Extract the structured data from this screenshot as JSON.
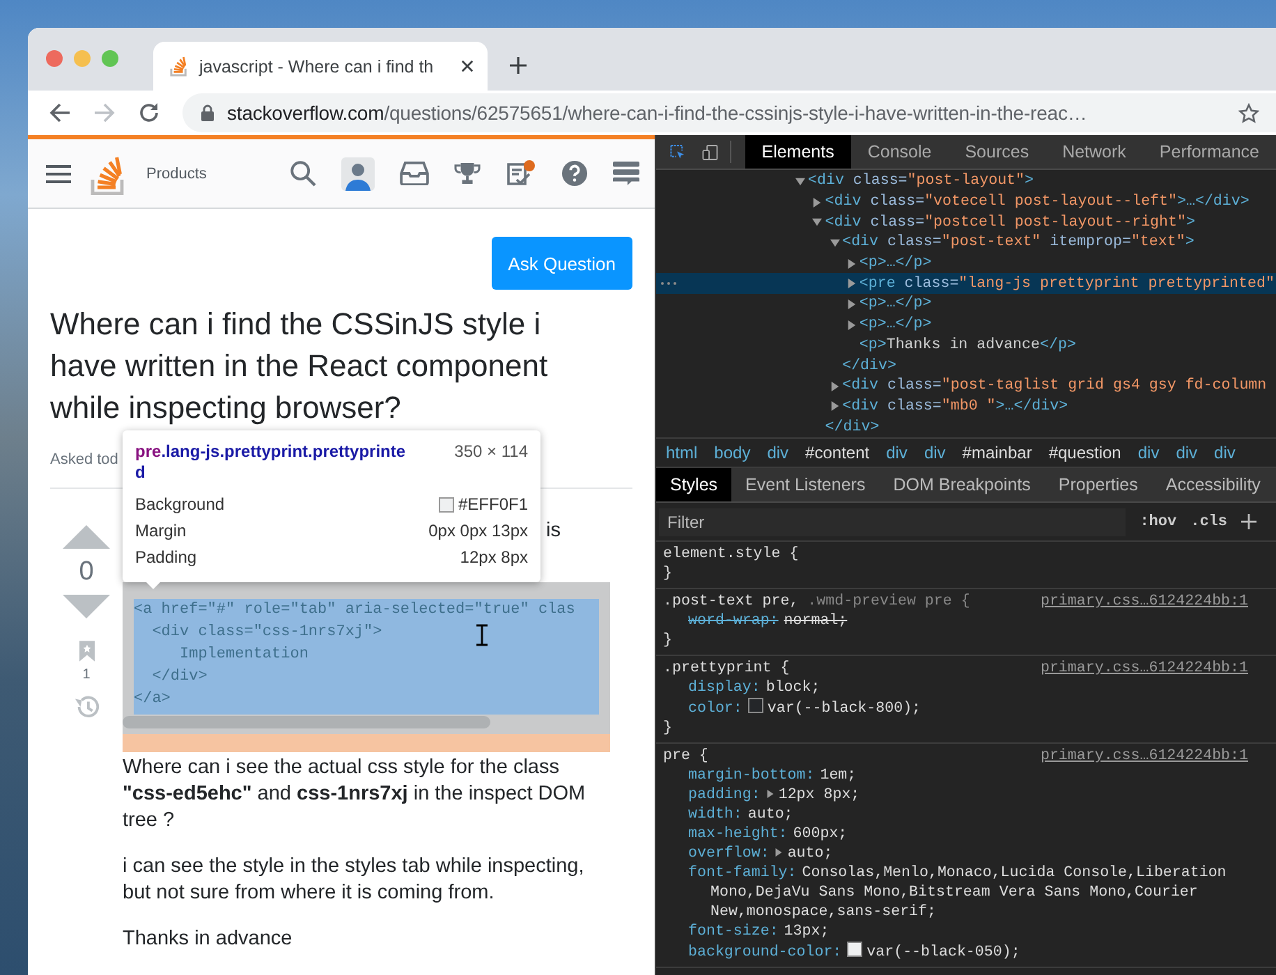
{
  "browser": {
    "tab": {
      "title": "javascript - Where can i find th"
    },
    "nav_buttons": [
      {
        "kind": "back",
        "disabled": false
      },
      {
        "kind": "forward",
        "disabled": true
      },
      {
        "kind": "reload",
        "disabled": false
      }
    ],
    "address": {
      "domain": "stackoverflow.com",
      "path": "/questions/62575651/where-can-i-find-the-cssinjs-style-i-have-written-in-the-reac…"
    }
  },
  "page": {
    "header": {
      "products": "Products"
    },
    "ask_button": "Ask Question",
    "title": "Where can i find the CSSinJS style i have written in the React component while inspecting browser?",
    "asked": "Asked tod",
    "fragment": "is",
    "votes": "0",
    "bookmarks": "1",
    "code_lines": [
      "<a href=\"#\" role=\"tab\" aria-selected=\"true\" clas",
      "  <div class=\"css-1nrs7xj\">",
      "     Implementation",
      "  </div>",
      "</a>"
    ],
    "paragraphs": [
      "Where can i see the actual css style for the class **\"css-ed5ehc\"** and **css-1nrs7xj** in the inspect DOM tree ?",
      "i can see the style in the styles tab while inspecting, but not sure from where it is coming from.",
      "Thanks in advance"
    ]
  },
  "tooltip": {
    "tag": "pre",
    "classes": ".lang-js.prettyprint.prettyprinted",
    "size": "350 × 114",
    "rows": [
      {
        "label": "Background",
        "value": "#EFF0F1",
        "color": "#eff0f1"
      },
      {
        "label": "Margin",
        "value": "0px 0px 13px"
      },
      {
        "label": "Padding",
        "value": "12px 8px"
      }
    ]
  },
  "devtools": {
    "tools": [
      {
        "label": "Elements",
        "selected": true
      },
      {
        "label": "Console",
        "selected": false
      },
      {
        "label": "Sources",
        "selected": false
      },
      {
        "label": "Network",
        "selected": false
      },
      {
        "label": "Performance",
        "selected": false
      }
    ],
    "tree": [
      {
        "expanded": true,
        "selected": false,
        "segments": [
          {
            "kind": "tag",
            "text": "<div"
          },
          {
            "kind": "attr",
            "text": " class="
          },
          {
            "kind": "value",
            "text": "\"post-layout\""
          },
          {
            "kind": "tag",
            "text": ">"
          }
        ],
        "children": [
          {
            "expanded": false,
            "selected": false,
            "segments": [
              {
                "kind": "tag",
                "text": "<div"
              },
              {
                "kind": "attr",
                "text": " class="
              },
              {
                "kind": "value",
                "text": "\"votecell post-layout--left\""
              },
              {
                "kind": "tag",
                "text": ">…</div>"
              }
            ]
          },
          {
            "expanded": true,
            "selected": false,
            "segments": [
              {
                "kind": "tag",
                "text": "<div"
              },
              {
                "kind": "attr",
                "text": " class="
              },
              {
                "kind": "value",
                "text": "\"postcell post-layout--right\""
              },
              {
                "kind": "tag",
                "text": ">"
              }
            ],
            "children": [
              {
                "expanded": true,
                "selected": false,
                "segments": [
                  {
                    "kind": "tag",
                    "text": "<div"
                  },
                  {
                    "kind": "attr",
                    "text": " class="
                  },
                  {
                    "kind": "value",
                    "text": "\"post-text\""
                  },
                  {
                    "kind": "attr",
                    "text": " itemprop="
                  },
                  {
                    "kind": "value",
                    "text": "\"text\""
                  },
                  {
                    "kind": "tag",
                    "text": ">"
                  }
                ],
                "children": [
                  {
                    "expanded": false,
                    "selected": false,
                    "segments": [
                      {
                        "kind": "tag",
                        "text": "<p>…</p>"
                      }
                    ]
                  },
                  {
                    "expanded": false,
                    "selected": true,
                    "segments": [
                      {
                        "kind": "tag",
                        "text": "<pre"
                      },
                      {
                        "kind": "attr",
                        "text": " class="
                      },
                      {
                        "kind": "value",
                        "text": "\"lang-js prettyprint prettyprinted\""
                      }
                    ]
                  },
                  {
                    "expanded": false,
                    "selected": false,
                    "segments": [
                      {
                        "kind": "tag",
                        "text": "<p>…</p>"
                      }
                    ]
                  },
                  {
                    "expanded": false,
                    "selected": false,
                    "segments": [
                      {
                        "kind": "tag",
                        "text": "<p>…</p>"
                      }
                    ]
                  },
                  {
                    "selected": false,
                    "segments": [
                      {
                        "kind": "tag",
                        "text": "<p>"
                      },
                      {
                        "kind": "text",
                        "text": "Thanks in advance"
                      },
                      {
                        "kind": "tag",
                        "text": "</p>"
                      }
                    ]
                  }
                ]
              },
              {
                "selected": false,
                "segments": [
                  {
                    "kind": "tag",
                    "text": "</div>"
                  }
                ]
              },
              {
                "expanded": false,
                "selected": false,
                "segments": [
                  {
                    "kind": "tag",
                    "text": "<div"
                  },
                  {
                    "kind": "attr",
                    "text": " class="
                  },
                  {
                    "kind": "value",
                    "text": "\"post-taglist grid gs4 gsy fd-column"
                  }
                ]
              },
              {
                "expanded": false,
                "selected": false,
                "segments": [
                  {
                    "kind": "tag",
                    "text": "<div"
                  },
                  {
                    "kind": "attr",
                    "text": " class="
                  },
                  {
                    "kind": "value",
                    "text": "\"mb0 \""
                  },
                  {
                    "kind": "tag",
                    "text": ">…</div>"
                  }
                ]
              }
            ]
          },
          {
            "selected": false,
            "segments": [
              {
                "kind": "tag",
                "text": "</div>"
              }
            ]
          }
        ]
      }
    ],
    "breadcrumbs": [
      {
        "kind": "tag",
        "text": "html"
      },
      {
        "kind": "tag",
        "text": "body"
      },
      {
        "kind": "tag",
        "text": "div"
      },
      {
        "kind": "id",
        "text": "#content"
      },
      {
        "kind": "tag",
        "text": "div"
      },
      {
        "kind": "tag",
        "text": "div"
      },
      {
        "kind": "id",
        "text": "#mainbar"
      },
      {
        "kind": "id",
        "text": "#question"
      },
      {
        "kind": "tag",
        "text": "div"
      },
      {
        "kind": "tag",
        "text": "div"
      },
      {
        "kind": "tag",
        "text": "div"
      }
    ],
    "panes": [
      {
        "label": "Styles",
        "selected": true
      },
      {
        "label": "Event Listeners",
        "selected": false
      },
      {
        "label": "DOM Breakpoints",
        "selected": false
      },
      {
        "label": "Properties",
        "selected": false
      },
      {
        "label": "Accessibility",
        "selected": false
      }
    ],
    "filter": {
      "placeholder": "Filter"
    },
    "filter_buttons": [
      ":hov",
      ".cls"
    ],
    "rules": [
      {
        "selector": [
          {
            "text": "element.style {",
            "matched": true
          }
        ],
        "close": "}"
      },
      {
        "selector": [
          {
            "text": ".post-text pre, ",
            "matched": true
          },
          {
            "text": ".wmd-preview pre {",
            "matched": false
          }
        ],
        "source": "primary.css…6124224bb:1",
        "close": "}",
        "properties": [
          {
            "name": "word-wrap:",
            "value": "normal;",
            "struck": true
          }
        ]
      },
      {
        "selector": [
          {
            "text": ".prettyprint {",
            "matched": true
          }
        ],
        "source": "primary.css…6124224bb:1",
        "close": "}",
        "properties": [
          {
            "name": "display:",
            "value": "block;",
            "struck": false
          },
          {
            "name": "color:",
            "value": "var(--black-800);",
            "struck": false,
            "color": "#242629"
          }
        ]
      },
      {
        "selector": [
          {
            "text": "pre {",
            "matched": true
          }
        ],
        "source": "primary.css…6124224bb:1",
        "properties": [
          {
            "name": "margin-bottom:",
            "value": "1em;",
            "struck": false
          },
          {
            "name": "padding:",
            "value": "12px 8px;",
            "struck": false,
            "expandable": true
          },
          {
            "name": "width:",
            "value": "auto;",
            "struck": false
          },
          {
            "name": "max-height:",
            "value": "600px;",
            "struck": false
          },
          {
            "name": "overflow:",
            "value": "auto;",
            "struck": false,
            "expandable": true
          },
          {
            "name": "font-family:",
            "value": "Consolas,Menlo,Monaco,Lucida Console,Liberation Mono,DejaVu Sans Mono,Bitstream Vera Sans Mono,Courier New,monospace,sans-serif;",
            "struck": false
          },
          {
            "name": "font-size:",
            "value": "13px;",
            "struck": false
          },
          {
            "name": "background-color:",
            "value": "var(--black-050);",
            "struck": false,
            "color": "#eff0f1"
          }
        ]
      }
    ]
  }
}
